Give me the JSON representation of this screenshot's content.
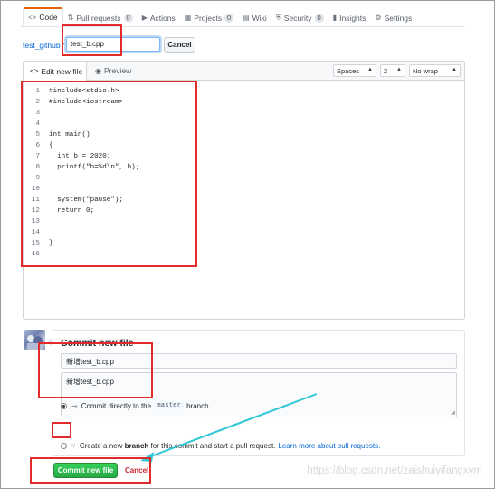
{
  "nav": {
    "tabs": [
      {
        "icon": "code-icon",
        "glyph": "<>",
        "label": "Code",
        "selected": true
      },
      {
        "icon": "pull-request-icon",
        "glyph": "⇅",
        "label": "Pull requests",
        "count": "0"
      },
      {
        "icon": "actions-icon",
        "glyph": "▶",
        "label": "Actions"
      },
      {
        "icon": "projects-icon",
        "glyph": "▦",
        "label": "Projects",
        "count": "0"
      },
      {
        "icon": "wiki-icon",
        "glyph": "▤",
        "label": "Wiki"
      },
      {
        "icon": "security-icon",
        "glyph": "⛨",
        "label": "Security",
        "count": "0"
      },
      {
        "icon": "insights-icon",
        "glyph": "▮",
        "label": "Insights"
      },
      {
        "icon": "settings-icon",
        "glyph": "⚙",
        "label": "Settings"
      }
    ]
  },
  "breadcrumb": {
    "repo": "test_github",
    "separator": "/",
    "filename": "test_b.cpp",
    "cancel_label": "Cancel"
  },
  "editor": {
    "tab_edit": "Edit new file",
    "tab_preview": "Preview",
    "indent_mode": "Spaces",
    "indent_size": "2",
    "wrap_mode": "No wrap",
    "lines": [
      {
        "n": "1",
        "text": "#include<stdio.h>"
      },
      {
        "n": "2",
        "text": "#include<iostream>"
      },
      {
        "n": "3",
        "text": ""
      },
      {
        "n": "4",
        "text": ""
      },
      {
        "n": "5",
        "text": "int main()"
      },
      {
        "n": "6",
        "text": "{"
      },
      {
        "n": "7",
        "text": "  int b = 2020;"
      },
      {
        "n": "8",
        "text": "  printf(\"b=%d\\n\", b);"
      },
      {
        "n": "9",
        "text": ""
      },
      {
        "n": "10",
        "text": ""
      },
      {
        "n": "11",
        "text": "  system(\"pause\");"
      },
      {
        "n": "12",
        "text": "  return 0;"
      },
      {
        "n": "13",
        "text": ""
      },
      {
        "n": "14",
        "text": ""
      },
      {
        "n": "15",
        "text": "}"
      },
      {
        "n": "16",
        "text": ""
      }
    ]
  },
  "commit": {
    "title": "Commit new file",
    "summary": "新增test_b.cpp",
    "description": "新增test_b.cpp",
    "option_direct_prefix": "Commit directly to the",
    "branch": "master",
    "option_direct_suffix": "branch.",
    "option_new_prefix": "Create a new",
    "option_new_bold": "branch",
    "option_new_suffix": "for this commit and start a pull request.",
    "learn_more": "Learn more about pull requests.",
    "commit_button": "Commit new file",
    "cancel_button": "Cancel"
  },
  "colors": {
    "annotation_red": "#e22b2b",
    "arrow_cyan": "#2fc6d6",
    "commit_green": "#28a745",
    "link_blue": "#0366d6"
  },
  "watermark": "https://blog.csdn.net/zaishuiyifangxym"
}
